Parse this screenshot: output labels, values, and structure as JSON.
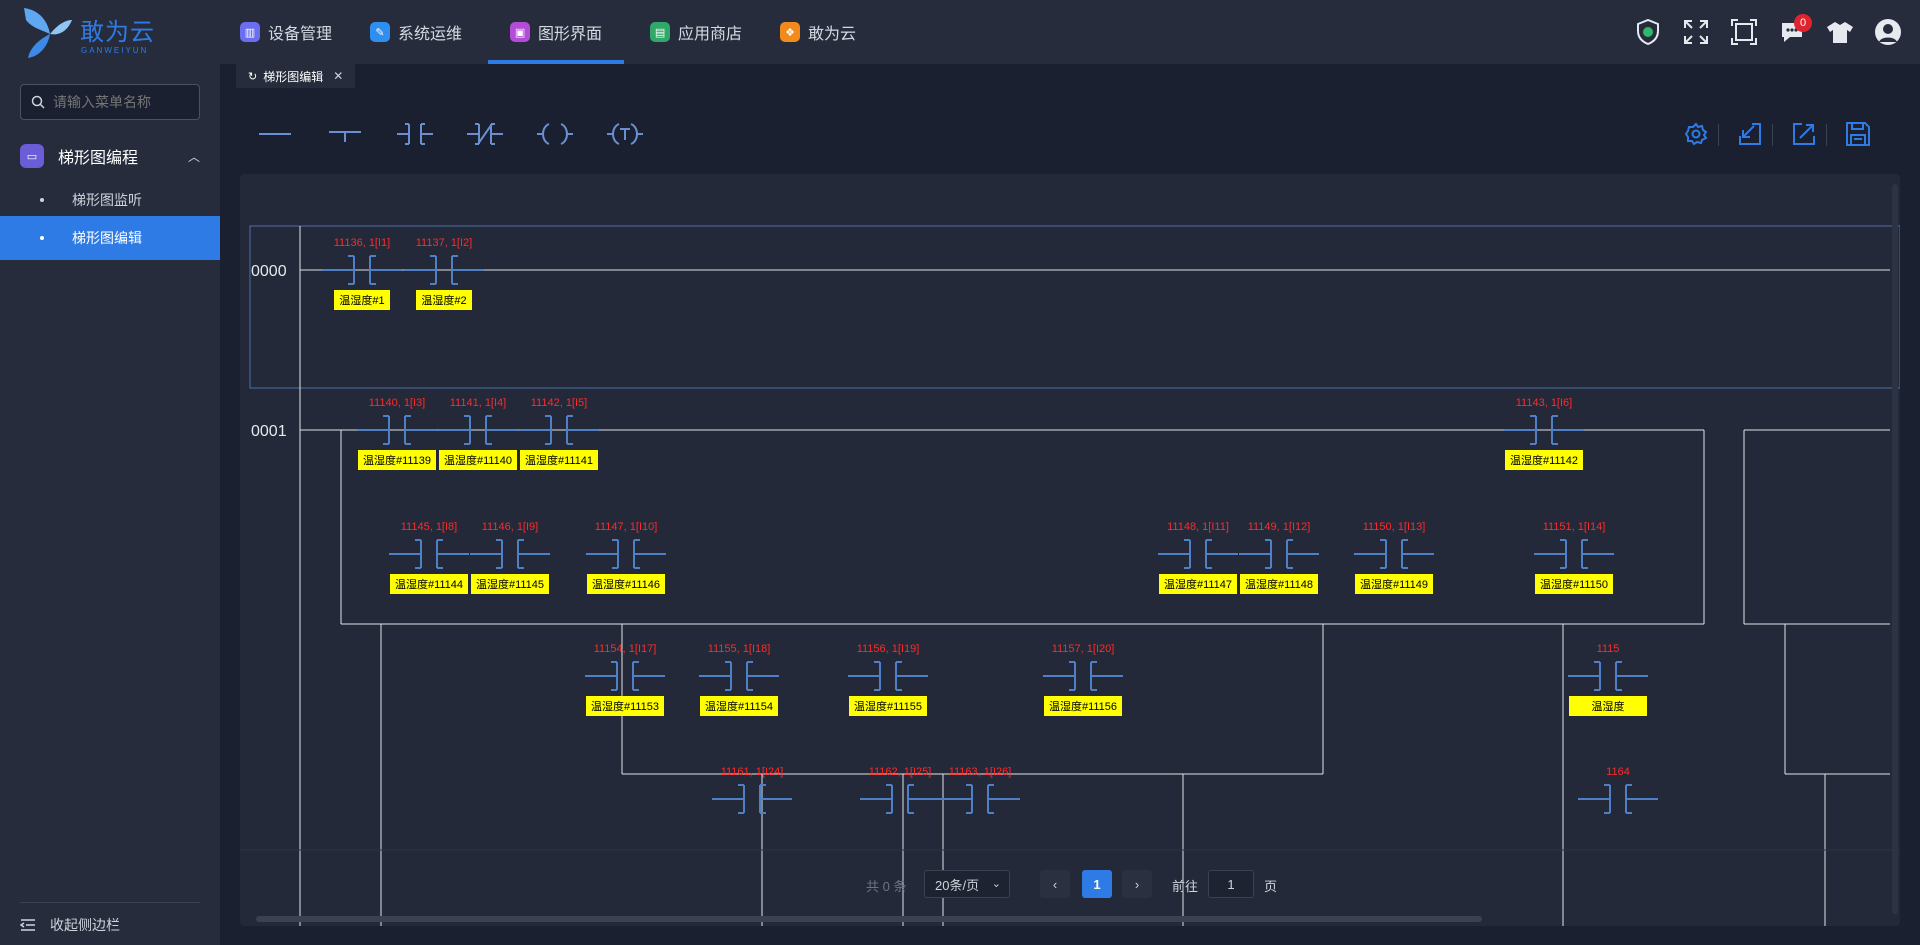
{
  "app": {
    "logo_text": "敢为云",
    "logo_sub": "GANWEIYUN"
  },
  "nav": [
    {
      "label": "设备管理",
      "icon": "device-icon",
      "color": "#6b6ef0"
    },
    {
      "label": "系统运维",
      "icon": "wrench-icon",
      "color": "#2e8ff0"
    },
    {
      "label": "图形界面",
      "icon": "graphic-icon",
      "color": "#b44cd8",
      "active": true
    },
    {
      "label": "应用商店",
      "icon": "store-icon",
      "color": "#2fa86a"
    },
    {
      "label": "敢为云",
      "icon": "cloud-icon",
      "color": "#f28a1c"
    }
  ],
  "header": {
    "notifications": "0"
  },
  "sidebar": {
    "search_placeholder": "请输入菜单名称",
    "group_label": "梯形图编程",
    "items": [
      {
        "label": "梯形图监听"
      },
      {
        "label": "梯形图编辑",
        "active": true
      }
    ],
    "collapse_label": "收起侧边栏"
  },
  "tabs": [
    {
      "label": "梯形图编辑"
    }
  ],
  "ladder": {
    "rungs": [
      {
        "id": "0000",
        "contacts": [
          {
            "addr": "11136, 1[I1]",
            "tag": "温湿度#1"
          },
          {
            "addr": "11137, 1[I2]",
            "tag": "温湿度#2"
          }
        ]
      },
      {
        "id": "0001",
        "contacts": [
          {
            "addr": "11140, 1[I3]",
            "tag": "温湿度#11139"
          },
          {
            "addr": "11141, 1[I4]",
            "tag": "温湿度#11140"
          },
          {
            "addr": "11142, 1[I5]",
            "tag": "温湿度#11141"
          },
          {
            "addr": "11143, 1[I6]",
            "tag": "温湿度#11142"
          },
          {
            "addr": "11145, 1[I8]",
            "tag": "温湿度#11144"
          },
          {
            "addr": "11146, 1[I9]",
            "tag": "温湿度#11145"
          },
          {
            "addr": "11147, 1[I10]",
            "tag": "温湿度#11146"
          },
          {
            "addr": "11148, 1[I11]",
            "tag": "温湿度#11147"
          },
          {
            "addr": "11149, 1[I12]",
            "tag": "温湿度#11148"
          },
          {
            "addr": "11150, 1[I13]",
            "tag": "温湿度#11149"
          },
          {
            "addr": "11151, 1[I14]",
            "tag": "温湿度#11150"
          },
          {
            "addr": "11154, 1[I17]",
            "tag": "温湿度#11153"
          },
          {
            "addr": "11155, 1[I18]",
            "tag": "温湿度#11154"
          },
          {
            "addr": "11156, 1[I19]",
            "tag": "温湿度#11155"
          },
          {
            "addr": "11157, 1[I20]",
            "tag": "温湿度#11156"
          },
          {
            "addr": "1115",
            "tag": "温湿度"
          },
          {
            "addr": "11161, 1[I24]",
            "tag": ""
          },
          {
            "addr": "11162, 1[I25]",
            "tag": ""
          },
          {
            "addr": "11163, 1[I26]",
            "tag": ""
          },
          {
            "addr": "1164",
            "tag": ""
          }
        ]
      }
    ]
  },
  "pager": {
    "total": "共 0 条",
    "size": "20条/页",
    "current": "1",
    "goto_label": "前往",
    "goto_value": "1",
    "page_suffix": "页"
  }
}
